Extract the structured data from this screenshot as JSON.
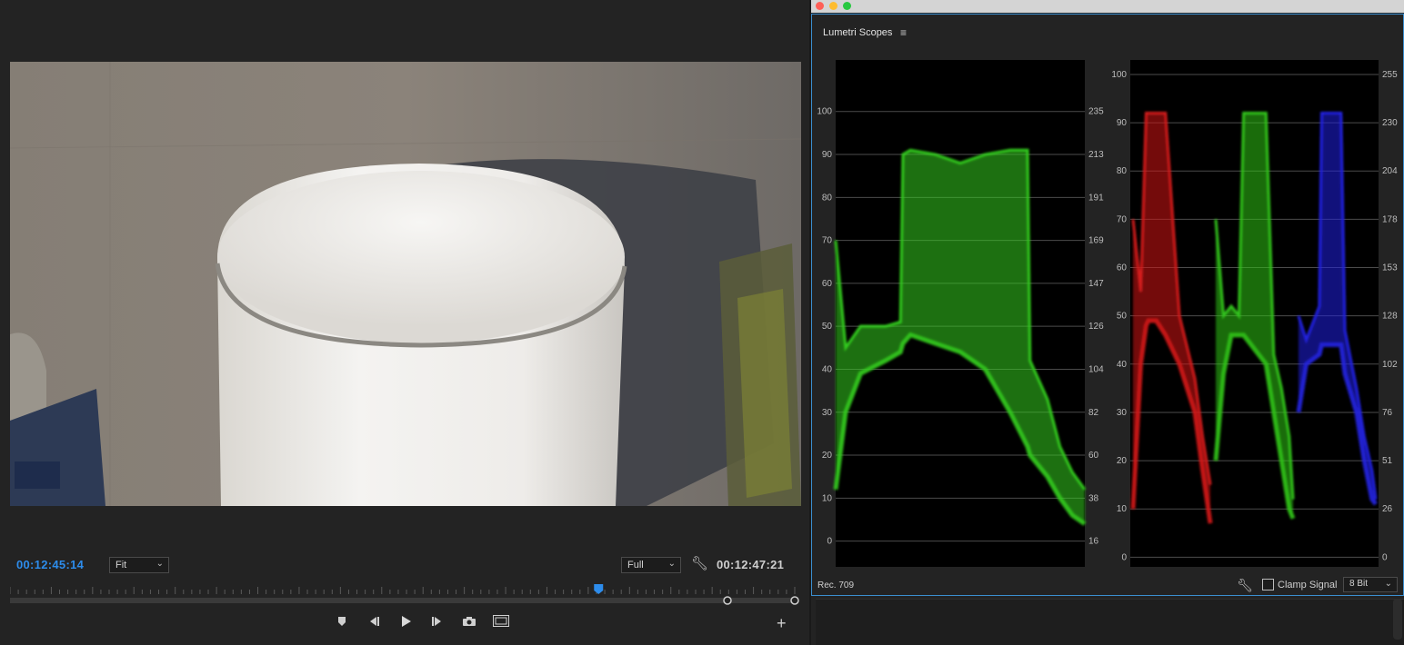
{
  "monitor": {
    "current_timecode": "00:12:45:14",
    "duration_timecode": "00:12:47:21",
    "zoom_select": "Fit",
    "resolution_select": "Full",
    "playhead_position": 0.75,
    "icons": {
      "settings": "wrench-icon",
      "marker": "add-marker-icon",
      "step_back": "step-back-icon",
      "play": "play-icon",
      "step_forward": "step-forward-icon",
      "export_frame": "camera-icon",
      "safe_margins": "safe-margins-icon",
      "add": "plus-icon"
    }
  },
  "scopes": {
    "panel_title": "Lumetri Scopes",
    "color_space": "Rec. 709",
    "clamp_signal_label": "Clamp Signal",
    "clamp_signal_checked": false,
    "bit_depth": "8 Bit",
    "accent_color": "#3b8fd0",
    "window_buttons": [
      "#ff5f57",
      "#febc2e",
      "#28c840"
    ]
  },
  "chart_data": [
    {
      "type": "area",
      "name_hint": "luma-waveform",
      "color": "#33cc1f",
      "y_left_ticks": [
        "100",
        "90",
        "80",
        "70",
        "60",
        "50",
        "40",
        "30",
        "20",
        "10",
        "0"
      ],
      "y_right_ticks": [
        "235",
        "213",
        "191",
        "169",
        "147",
        "126",
        "104",
        "82",
        "60",
        "38",
        "16"
      ],
      "ylim": [
        -6,
        112
      ],
      "x": [
        0,
        0.04,
        0.1,
        0.2,
        0.26,
        0.27,
        0.3,
        0.4,
        0.5,
        0.6,
        0.7,
        0.77,
        0.78,
        0.85,
        0.9,
        0.95,
        1.0
      ],
      "top": [
        70,
        45,
        50,
        50,
        51,
        90,
        91,
        90,
        88,
        90,
        91,
        91,
        42,
        33,
        22,
        16,
        12
      ],
      "bottom": [
        12,
        30,
        39,
        42,
        44,
        46,
        48,
        46,
        44,
        40,
        30,
        22,
        20,
        15,
        10,
        6,
        4
      ]
    },
    {
      "type": "area",
      "name_hint": "rgb-parade",
      "y_left_ticks": [
        "100",
        "90",
        "80",
        "70",
        "60",
        "50",
        "40",
        "30",
        "20",
        "10",
        "0"
      ],
      "y_right_ticks": [
        "255",
        "230",
        "204",
        "178",
        "153",
        "128",
        "102",
        "76",
        "51",
        "26",
        "0"
      ],
      "ylim": [
        -2,
        103
      ],
      "series": [
        {
          "name": "R",
          "color": "#d41a1a",
          "x": [
            0,
            0.1,
            0.17,
            0.2,
            0.3,
            0.42,
            0.6,
            0.8,
            0.9,
            1.0
          ],
          "top": [
            70,
            55,
            92,
            92,
            92,
            92,
            50,
            37,
            25,
            15
          ],
          "bottom": [
            10,
            40,
            48,
            49,
            49,
            46,
            40,
            30,
            18,
            7
          ]
        },
        {
          "name": "G",
          "color": "#30c41a",
          "x": [
            0,
            0.1,
            0.2,
            0.3,
            0.36,
            0.65,
            0.75,
            0.85,
            0.95,
            1.0
          ],
          "top": [
            70,
            50,
            52,
            50,
            92,
            92,
            42,
            35,
            25,
            12
          ],
          "bottom": [
            20,
            38,
            46,
            46,
            46,
            40,
            30,
            20,
            10,
            8
          ]
        },
        {
          "name": "B",
          "color": "#2222e0",
          "x": [
            0,
            0.1,
            0.27,
            0.3,
            0.55,
            0.6,
            0.75,
            0.85,
            0.95,
            1.0
          ],
          "top": [
            50,
            45,
            52,
            92,
            92,
            47,
            35,
            25,
            18,
            12
          ],
          "bottom": [
            30,
            40,
            42,
            44,
            44,
            38,
            30,
            20,
            12,
            11
          ]
        }
      ]
    }
  ]
}
